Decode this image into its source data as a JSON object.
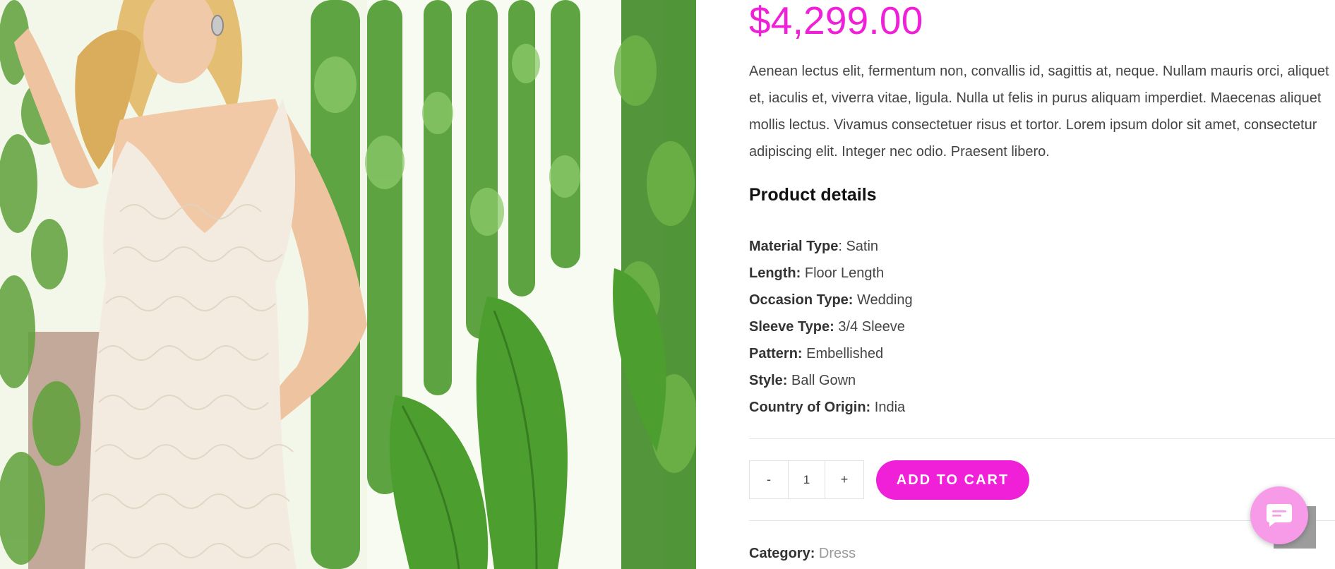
{
  "product": {
    "price": "$4,299.00",
    "description": "Aenean lectus elit, fermentum non, convallis id, sagittis at, neque. Nullam mauris orci, aliquet et, iaculis et, viverra vitae, ligula. Nulla ut felis in purus aliquam imperdiet. Maecenas aliquet mollis lectus. Vivamus consectetuer risus et tortor. Lorem ipsum dolor sit amet, consectetur adipiscing elit. Integer nec odio. Praesent libero.",
    "details_heading": "Product details",
    "details": [
      {
        "label": "Material Type",
        "sep": ": ",
        "value": "Satin"
      },
      {
        "label": "Length:",
        "sep": " ",
        "value": "Floor Length"
      },
      {
        "label": "Occasion Type:",
        "sep": " ",
        "value": "Wedding"
      },
      {
        "label": "Sleeve Type:",
        "sep": " ",
        "value": "3/4 Sleeve"
      },
      {
        "label": "Pattern:",
        "sep": " ",
        "value": "Embellished"
      },
      {
        "label": "Style:",
        "sep": " ",
        "value": "Ball Gown"
      },
      {
        "label": "Country of Origin:",
        "sep": " ",
        "value": "India"
      }
    ]
  },
  "cart": {
    "minus_label": "-",
    "quantity": "1",
    "plus_label": "+",
    "add_to_cart_label": "ADD TO CART"
  },
  "meta": {
    "category_label": "Category:",
    "category_value": "Dress"
  },
  "widgets": {
    "chat_icon": "chat-bubble-icon",
    "scroll_top_icon": "scroll-to-top-button"
  },
  "colors": {
    "accent": "#f01fd8",
    "chat_bubble": "#f79be9",
    "text": "#444444"
  }
}
